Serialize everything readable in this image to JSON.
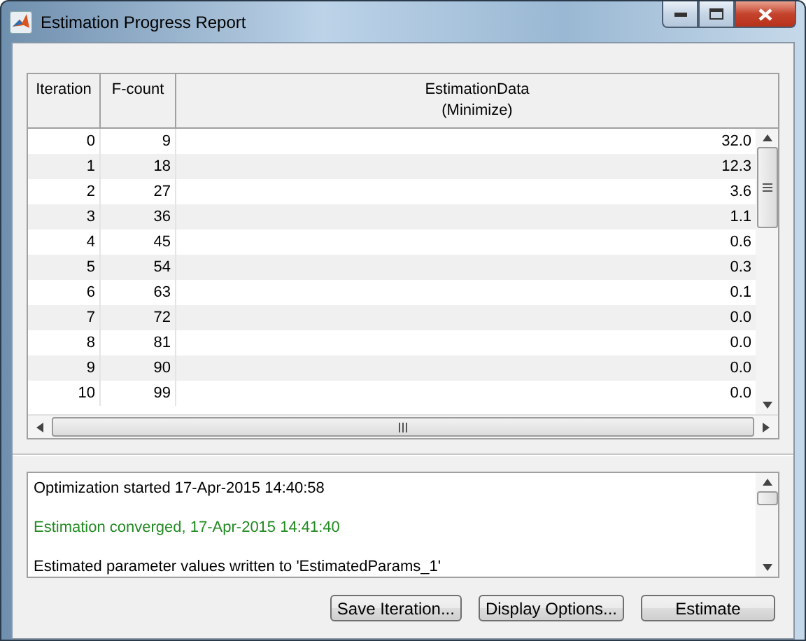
{
  "window": {
    "title": "Estimation Progress Report"
  },
  "table": {
    "columns": [
      "Iteration",
      "F-count",
      "EstimationData"
    ],
    "column_subtitle": "(Minimize)",
    "rows": [
      {
        "iteration": "0",
        "fcount": "9",
        "value": "32.0"
      },
      {
        "iteration": "1",
        "fcount": "18",
        "value": "12.3"
      },
      {
        "iteration": "2",
        "fcount": "27",
        "value": "3.6"
      },
      {
        "iteration": "3",
        "fcount": "36",
        "value": "1.1"
      },
      {
        "iteration": "4",
        "fcount": "45",
        "value": "0.6"
      },
      {
        "iteration": "5",
        "fcount": "54",
        "value": "0.3"
      },
      {
        "iteration": "6",
        "fcount": "63",
        "value": "0.1"
      },
      {
        "iteration": "7",
        "fcount": "72",
        "value": "0.0"
      },
      {
        "iteration": "8",
        "fcount": "81",
        "value": "0.0"
      },
      {
        "iteration": "9",
        "fcount": "90",
        "value": "0.0"
      },
      {
        "iteration": "10",
        "fcount": "99",
        "value": "0.0"
      }
    ]
  },
  "log": [
    {
      "kind": "info",
      "text": "Optimization started 17-Apr-2015 14:40:58"
    },
    {
      "kind": "blank"
    },
    {
      "kind": "success",
      "text": "Estimation converged, 17-Apr-2015 14:41:40"
    },
    {
      "kind": "blank"
    },
    {
      "kind": "info",
      "text": "Estimated parameter values written to 'EstimatedParams_1'"
    }
  ],
  "buttons": [
    "Save Iteration...",
    "Display Options...",
    "Estimate"
  ]
}
